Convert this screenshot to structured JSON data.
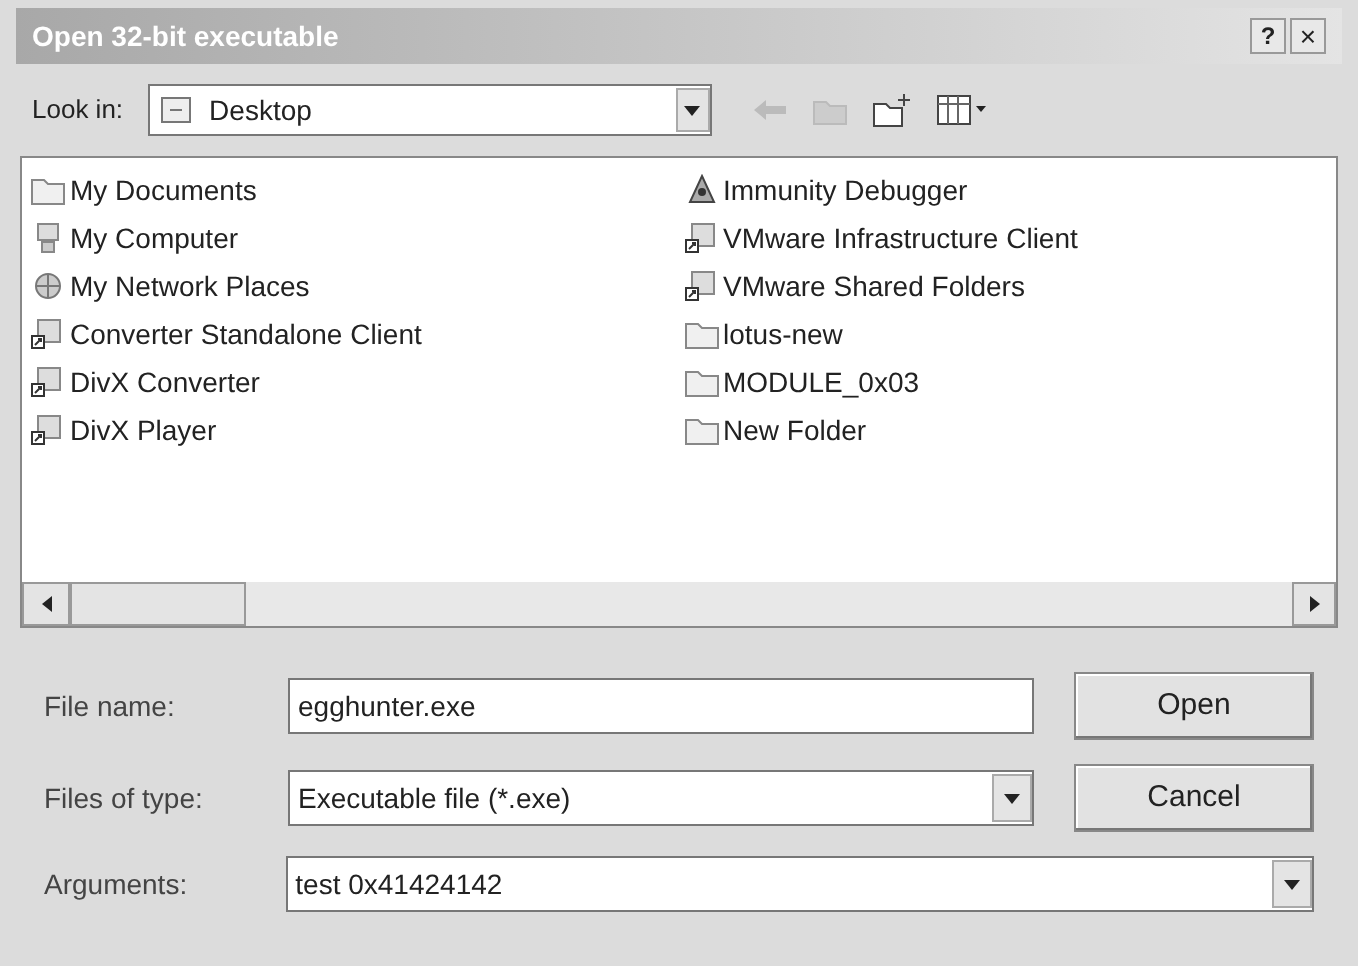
{
  "window": {
    "title": "Open 32-bit executable",
    "help": "?",
    "close": "×"
  },
  "look_in": {
    "label": "Look in:",
    "value": "Desktop"
  },
  "files": [
    {
      "name": "My Documents",
      "kind": "folder"
    },
    {
      "name": "My Computer",
      "kind": "computer"
    },
    {
      "name": "My Network Places",
      "kind": "network"
    },
    {
      "name": "Converter Standalone Client",
      "kind": "shortcut"
    },
    {
      "name": "DivX Converter",
      "kind": "shortcut"
    },
    {
      "name": "DivX Player",
      "kind": "shortcut"
    },
    {
      "name": "Immunity Debugger",
      "kind": "app"
    },
    {
      "name": "VMware Infrastructure Client",
      "kind": "shortcut"
    },
    {
      "name": "VMware Shared Folders",
      "kind": "shortcut"
    },
    {
      "name": "lotus-new",
      "kind": "folder"
    },
    {
      "name": "MODULE_0x03",
      "kind": "folder"
    },
    {
      "name": "New Folder",
      "kind": "folder"
    }
  ],
  "fields": [
    {
      "label": "File name:",
      "value": "egghunter.exe",
      "kind": "text"
    },
    {
      "label": "Files of type:",
      "value": "Executable file (*.exe)",
      "kind": "combo"
    },
    {
      "label": "Arguments:",
      "value": "test 0x41424142",
      "kind": "wide-combo"
    }
  ],
  "buttons": [
    "Open",
    "Cancel"
  ]
}
